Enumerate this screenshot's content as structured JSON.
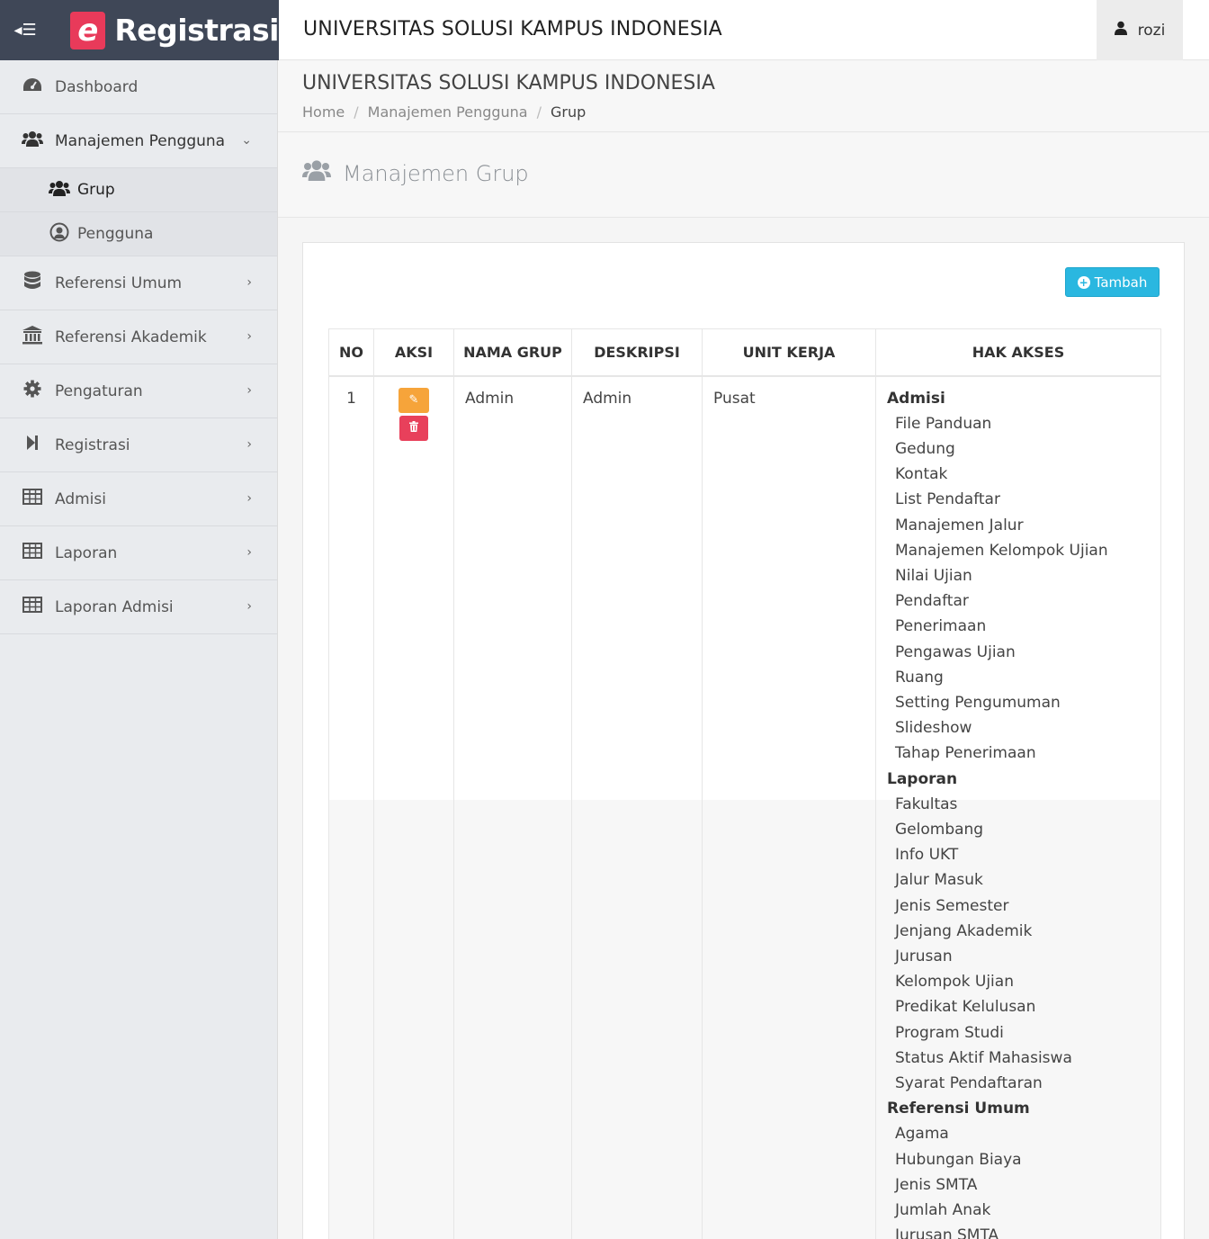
{
  "brand": {
    "logo_letter": "e",
    "name": "Registrasi",
    "toggle_icon": "menu-icon",
    "color": "#3f4757",
    "logo_color": "#e83a5a"
  },
  "header": {
    "title": "UNIVERSITAS SOLUSI KAMPUS INDONESIA",
    "user": "rozi",
    "user_icon": "user-icon"
  },
  "sidebar": {
    "items": [
      {
        "label": "Dashboard",
        "icon": "dashboard-icon"
      },
      {
        "label": "Manajemen Pengguna",
        "icon": "users-icon",
        "expanded": true,
        "children": [
          {
            "label": "Grup",
            "icon": "users-icon",
            "active": true
          },
          {
            "label": "Pengguna",
            "icon": "user-circle-icon"
          }
        ]
      },
      {
        "label": "Referensi Umum",
        "icon": "database-icon"
      },
      {
        "label": "Referensi Akademik",
        "icon": "institution-icon"
      },
      {
        "label": "Pengaturan",
        "icon": "gear-icon"
      },
      {
        "label": "Registrasi",
        "icon": "step-forward-icon"
      },
      {
        "label": "Admisi",
        "icon": "table-icon"
      },
      {
        "label": "Laporan",
        "icon": "table-icon"
      },
      {
        "label": "Laporan Admisi",
        "icon": "table-icon"
      }
    ]
  },
  "content": {
    "title": "UNIVERSITAS SOLUSI KAMPUS INDONESIA",
    "breadcrumb": [
      "Home",
      "Manajemen Pengguna",
      "Grup"
    ],
    "page_title": "Manajemen Grup",
    "add_button": "Tambah"
  },
  "table": {
    "headers": [
      "NO",
      "AKSI",
      "NAMA GRUP",
      "DESKRIPSI",
      "UNIT KERJA",
      "HAK AKSES"
    ],
    "rows": [
      {
        "no": "1",
        "nama_grup": "Admin",
        "deskripsi": "Admin",
        "unit_kerja": "Pusat",
        "hak_akses": [
          {
            "group": "Admisi",
            "items": [
              "File Panduan",
              "Gedung",
              "Kontak",
              "List Pendaftar",
              "Manajemen Jalur",
              "Manajemen Kelompok Ujian",
              "Nilai Ujian",
              "Pendaftar",
              "Penerimaan",
              "Pengawas Ujian",
              "Ruang",
              "Setting Pengumuman",
              "Slideshow",
              "Tahap Penerimaan"
            ]
          },
          {
            "group": "Laporan",
            "items": [
              "Fakultas",
              "Gelombang",
              "Info UKT",
              "Jalur Masuk",
              "Jenis Semester",
              "Jenjang Akademik",
              "Jurusan",
              "Kelompok Ujian",
              "Predikat Kelulusan",
              "Program Studi",
              "Status Aktif Mahasiswa",
              "Syarat Pendaftaran"
            ]
          },
          {
            "group": "Referensi Umum",
            "items": [
              "Agama",
              "Hubungan Biaya",
              "Jenis SMTA",
              "Jumlah Anak",
              "Jurusan SMTA"
            ]
          }
        ]
      }
    ]
  }
}
